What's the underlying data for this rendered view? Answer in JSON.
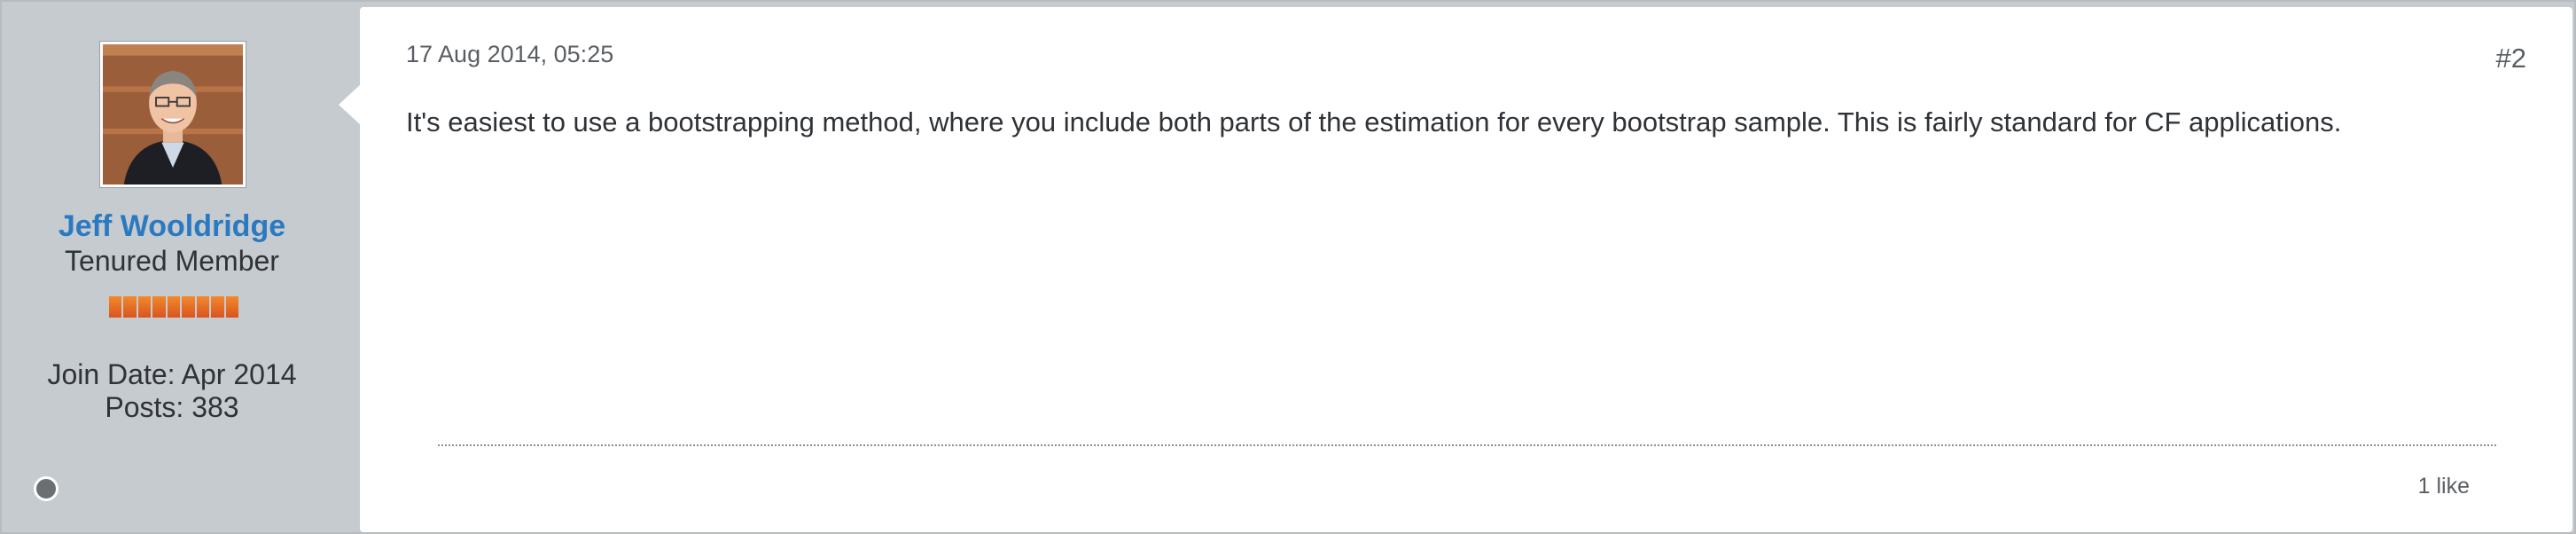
{
  "post": {
    "author": {
      "name": "Jeff Wooldridge",
      "title": "Tenured Member",
      "join_date": "Join Date: Apr 2014",
      "posts": "Posts: 383",
      "rank_bars": 9,
      "status": "offline"
    },
    "date": "17 Aug 2014, 05:25",
    "number": "#2",
    "body": "It's easiest to use a bootstrapping method, where you include both parts of the estimation for every bootstrap sample. This is fairly standard for CF applications.",
    "likes": "1 like"
  },
  "colors": {
    "sidebar_bg": "#c6cbd0",
    "author_link": "#2b79c0",
    "rank_bar": "#e0672a"
  }
}
